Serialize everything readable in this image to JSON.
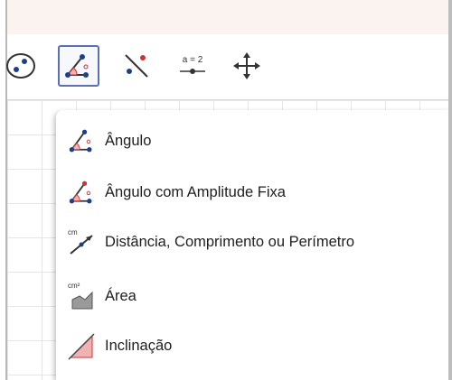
{
  "toolbar": {
    "tools": [
      {
        "icon": "circle-through-points-icon"
      },
      {
        "icon": "angle-icon",
        "selected": true
      },
      {
        "icon": "perpendicular-line-icon"
      },
      {
        "icon": "slider-icon",
        "label": "a = 2"
      },
      {
        "icon": "move-graphics-view-icon"
      }
    ]
  },
  "submenu": {
    "items": [
      {
        "label": "Ângulo",
        "icon": "angle-icon"
      },
      {
        "label": "Ângulo com Amplitude Fixa",
        "icon": "angle-fixed-size-icon"
      },
      {
        "label": "Distância, Comprimento ou Perímetro",
        "icon": "distance-icon",
        "icon_text": "cm"
      },
      {
        "label": "Área",
        "icon": "area-icon",
        "icon_text": "cm²"
      },
      {
        "label": "Inclinação",
        "icon": "slope-icon"
      }
    ]
  },
  "colors": {
    "selected_border": "#5b6fb3",
    "angle_red": "#cc3333",
    "point_blue": "#1c3f8c",
    "title_strip": "#fbf3ef"
  }
}
